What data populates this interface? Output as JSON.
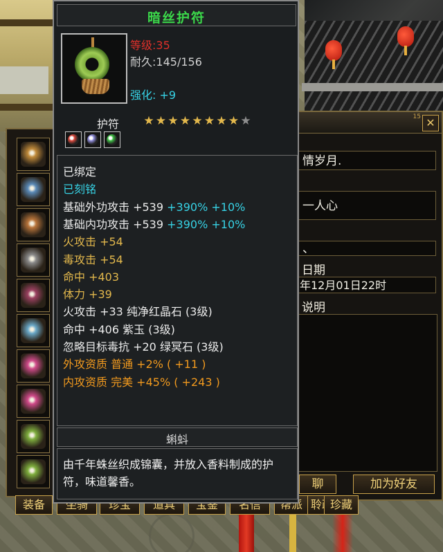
{
  "tooltip": {
    "item_name": "暗丝护符",
    "level_label": "等级",
    "level_value": "35",
    "durability_label": "耐久",
    "durability_value": "145/156",
    "enhance_label": "强化",
    "enhance_value": "+9",
    "item_type": "护符",
    "stars_filled": 8,
    "stars_total": 9,
    "colors": {
      "title": "#3bd84a",
      "star_filled": "#e3b84c",
      "star_empty": "#8e8e8e"
    },
    "gems": [
      {
        "icon": "red-gem-icon",
        "color": "#d9463a"
      },
      {
        "icon": "purple-gem-icon",
        "color": "#8d8ad8"
      },
      {
        "icon": "green-gem-icon",
        "color": "#3dbd43"
      }
    ],
    "attributes": [
      {
        "text": "已绑定",
        "color": "white"
      },
      {
        "text": "已刻铭",
        "color": "cyan"
      },
      {
        "text": "基础外功攻击 +539",
        "extra": " +390% +10%",
        "color": "white"
      },
      {
        "text": "基础内功攻击 +539",
        "extra": " +390% +10%",
        "color": "white"
      },
      {
        "text": "火攻击 +54",
        "color": "gold"
      },
      {
        "text": "毒攻击 +54",
        "color": "gold"
      },
      {
        "text": "命中 +403",
        "color": "gold"
      },
      {
        "text": "体力 +39",
        "color": "gold"
      },
      {
        "text": "火攻击 +33 纯净红晶石 (3级)",
        "color": "white"
      },
      {
        "text": "命中 +406 紫玉 (3级)",
        "color": "white"
      },
      {
        "text": "忽略目标毒抗 +20 绿冥石 (3级)",
        "color": "white"
      },
      {
        "text": "外攻资质  普通 +2% ( +11 )",
        "color": "orange"
      },
      {
        "text": "内攻资质  完美 +45% ( +243 )",
        "color": "orange"
      }
    ],
    "maker": "蝌蚪",
    "description": "由千年蛛丝织成锦囊，并放入香料制成的护符，味道馨香。"
  },
  "info_window": {
    "close_glyph": "✕",
    "mark": "15",
    "field1": "情岁月.",
    "field2": "一人心",
    "field3": "、",
    "date_label": "日期",
    "date_value": "年12月01日22时",
    "desc_label": "说明",
    "chat_button": "聊",
    "add_friend_button": "加为好友"
  },
  "tabs": [
    "装备",
    "坐骑",
    "珍宝",
    "道具",
    "宝鉴",
    "名信",
    "帮派",
    "聆政",
    "珍藏"
  ],
  "equipment_slots": [
    {
      "icon": "pauldron-icon",
      "color": "#c08a3a"
    },
    {
      "icon": "scroll-icon",
      "color": "#5a8ab8"
    },
    {
      "icon": "bracer-icon",
      "color": "#b8743a"
    },
    {
      "icon": "gauntlet-icon",
      "color": "#8a8a8a"
    },
    {
      "icon": "belt-icon",
      "color": "#9a4060"
    },
    {
      "icon": "boots-icon",
      "color": "#6aa8c8"
    },
    {
      "icon": "ring-icon",
      "color": "#d04a8a"
    },
    {
      "icon": "ring-icon",
      "color": "#d04a8a"
    },
    {
      "icon": "amulet-icon",
      "color": "#7fae3e"
    },
    {
      "icon": "amulet-icon",
      "color": "#7fae3e"
    }
  ]
}
